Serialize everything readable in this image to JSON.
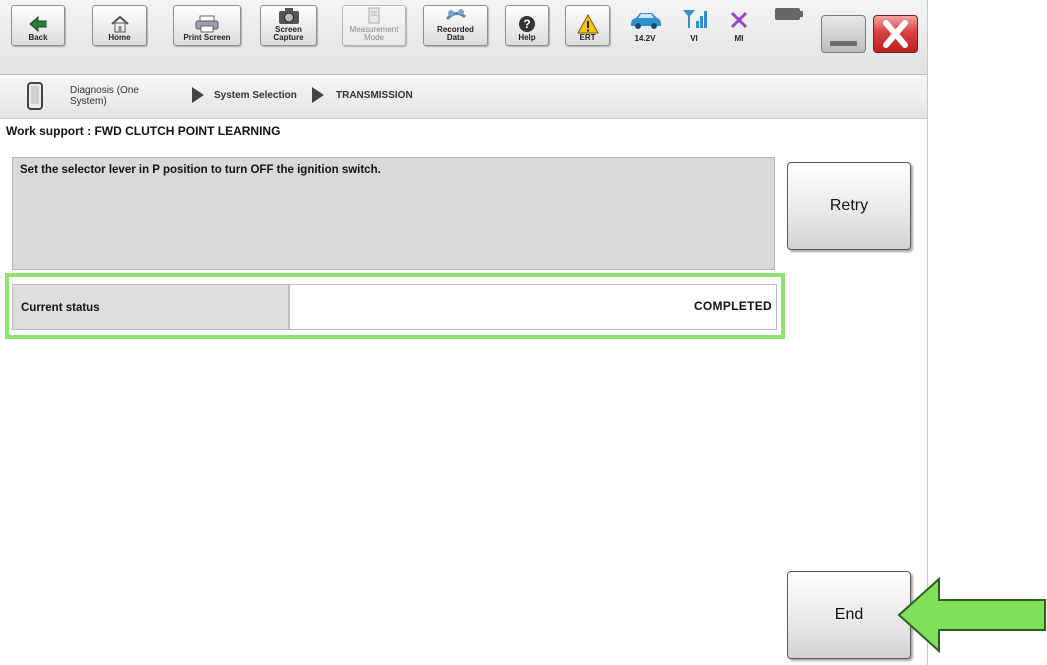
{
  "toolbar": {
    "back": "Back",
    "home": "Home",
    "print": "Print Screen",
    "capture": "Screen\nCapture",
    "measurement": "Measurement\nMode",
    "recorded": "Recorded\nData",
    "help": "Help",
    "ert": "ERT",
    "battery_voltage": "14.2V",
    "vi": "VI",
    "mi": "MI"
  },
  "breadcrumb": {
    "item1": "Diagnosis (One\nSystem)",
    "item2": "System Selection",
    "item3": "TRANSMISSION"
  },
  "page": {
    "title": "Work support : FWD CLUTCH POINT LEARNING",
    "message": "Set the selector lever in P position to turn OFF the ignition switch.",
    "status_label": "Current status",
    "status_value": "COMPLETED"
  },
  "buttons": {
    "retry": "Retry",
    "end": "End"
  },
  "colors": {
    "highlight": "#8ee36b",
    "arrow": "#7fe05a",
    "close_button": "#d84141"
  }
}
